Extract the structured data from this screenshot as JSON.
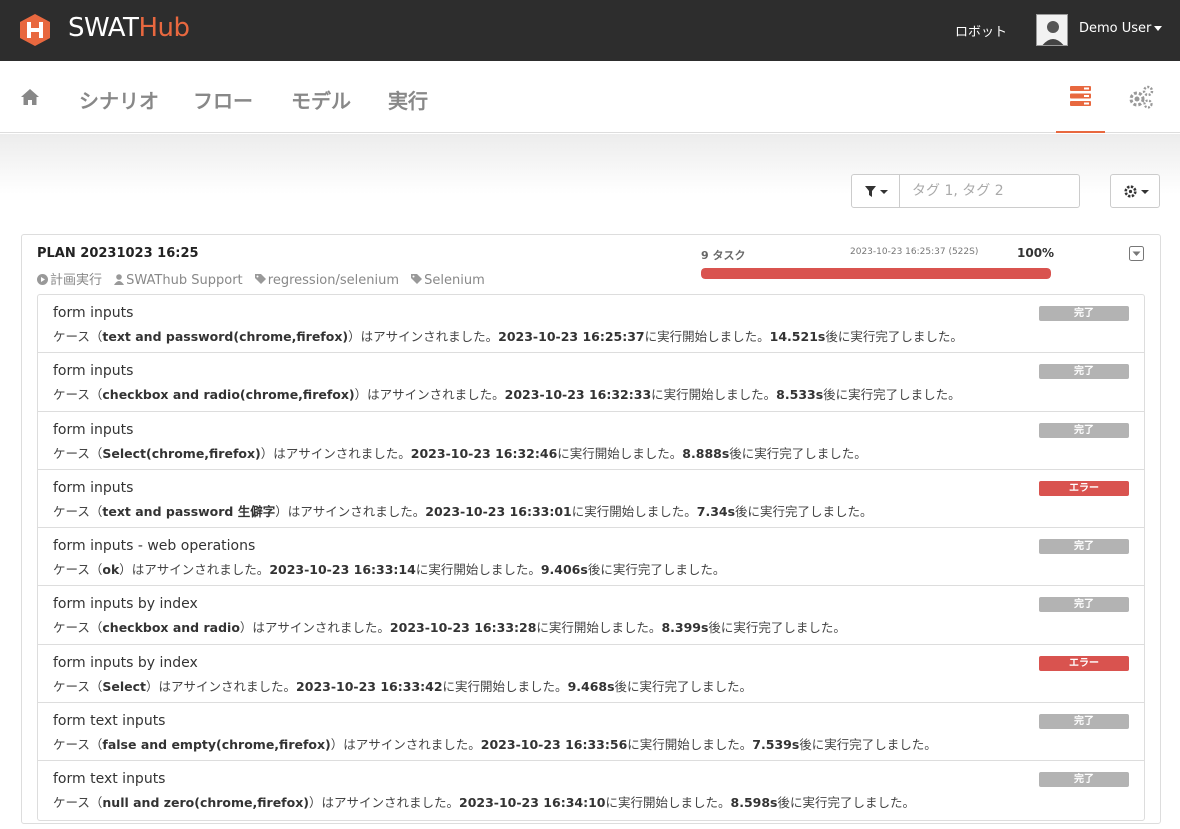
{
  "header": {
    "brand_part1": "SWAT",
    "brand_part2": "Hub",
    "robot_label": "ロボット",
    "user_name": "Demo User"
  },
  "nav": {
    "tabs": [
      "シナリオ",
      "フロー",
      "モデル",
      "実行"
    ]
  },
  "filter": {
    "placeholder": "タグ 1, タグ 2"
  },
  "plan": {
    "title": "PLAN 20231023 16:25",
    "run_type": "計画実行",
    "owner": "SWAThub Support",
    "tags": [
      "regression/selenium",
      "Selenium"
    ],
    "task_count": "9 タスク",
    "time": "2023-10-23 16:25:37 (522S)",
    "percent": "100%",
    "progress_fraction": 1.0
  },
  "colors": {
    "accent": "#e8683f",
    "done": "#b3b3b3",
    "error": "#d9534f"
  },
  "tasks": [
    {
      "name": "form inputs",
      "case": "text and password(chrome,firefox)",
      "started": "2023-10-23 16:25:37",
      "duration": "14.521s",
      "status": "完了",
      "status_type": "done"
    },
    {
      "name": "form inputs",
      "case": "checkbox and radio(chrome,firefox)",
      "started": "2023-10-23 16:32:33",
      "duration": "8.533s",
      "status": "完了",
      "status_type": "done"
    },
    {
      "name": "form inputs",
      "case": "Select(chrome,firefox)",
      "started": "2023-10-23 16:32:46",
      "duration": "8.888s",
      "status": "完了",
      "status_type": "done"
    },
    {
      "name": "form inputs",
      "case": "text and password 生僻字",
      "started": "2023-10-23 16:33:01",
      "duration": "7.34s",
      "status": "エラー",
      "status_type": "error"
    },
    {
      "name": "form inputs - web operations",
      "case": "ok",
      "started": "2023-10-23 16:33:14",
      "duration": "9.406s",
      "status": "完了",
      "status_type": "done"
    },
    {
      "name": "form inputs by index",
      "case": "checkbox and radio",
      "started": "2023-10-23 16:33:28",
      "duration": "8.399s",
      "status": "完了",
      "status_type": "done"
    },
    {
      "name": "form inputs by index",
      "case": "Select",
      "started": "2023-10-23 16:33:42",
      "duration": "9.468s",
      "status": "エラー",
      "status_type": "error"
    },
    {
      "name": "form text inputs",
      "case": "false and empty(chrome,firefox)",
      "started": "2023-10-23 16:33:56",
      "duration": "7.539s",
      "status": "完了",
      "status_type": "done"
    },
    {
      "name": "form text inputs",
      "case": "null and zero(chrome,firefox)",
      "started": "2023-10-23 16:34:10",
      "duration": "8.598s",
      "status": "完了",
      "status_type": "done"
    }
  ],
  "text": {
    "case_prefix": "ケース（",
    "assigned": "）はアサインされました。",
    "started_suffix": "に実行開始しました。",
    "finished_suffix": "後に実行完了しました。"
  }
}
